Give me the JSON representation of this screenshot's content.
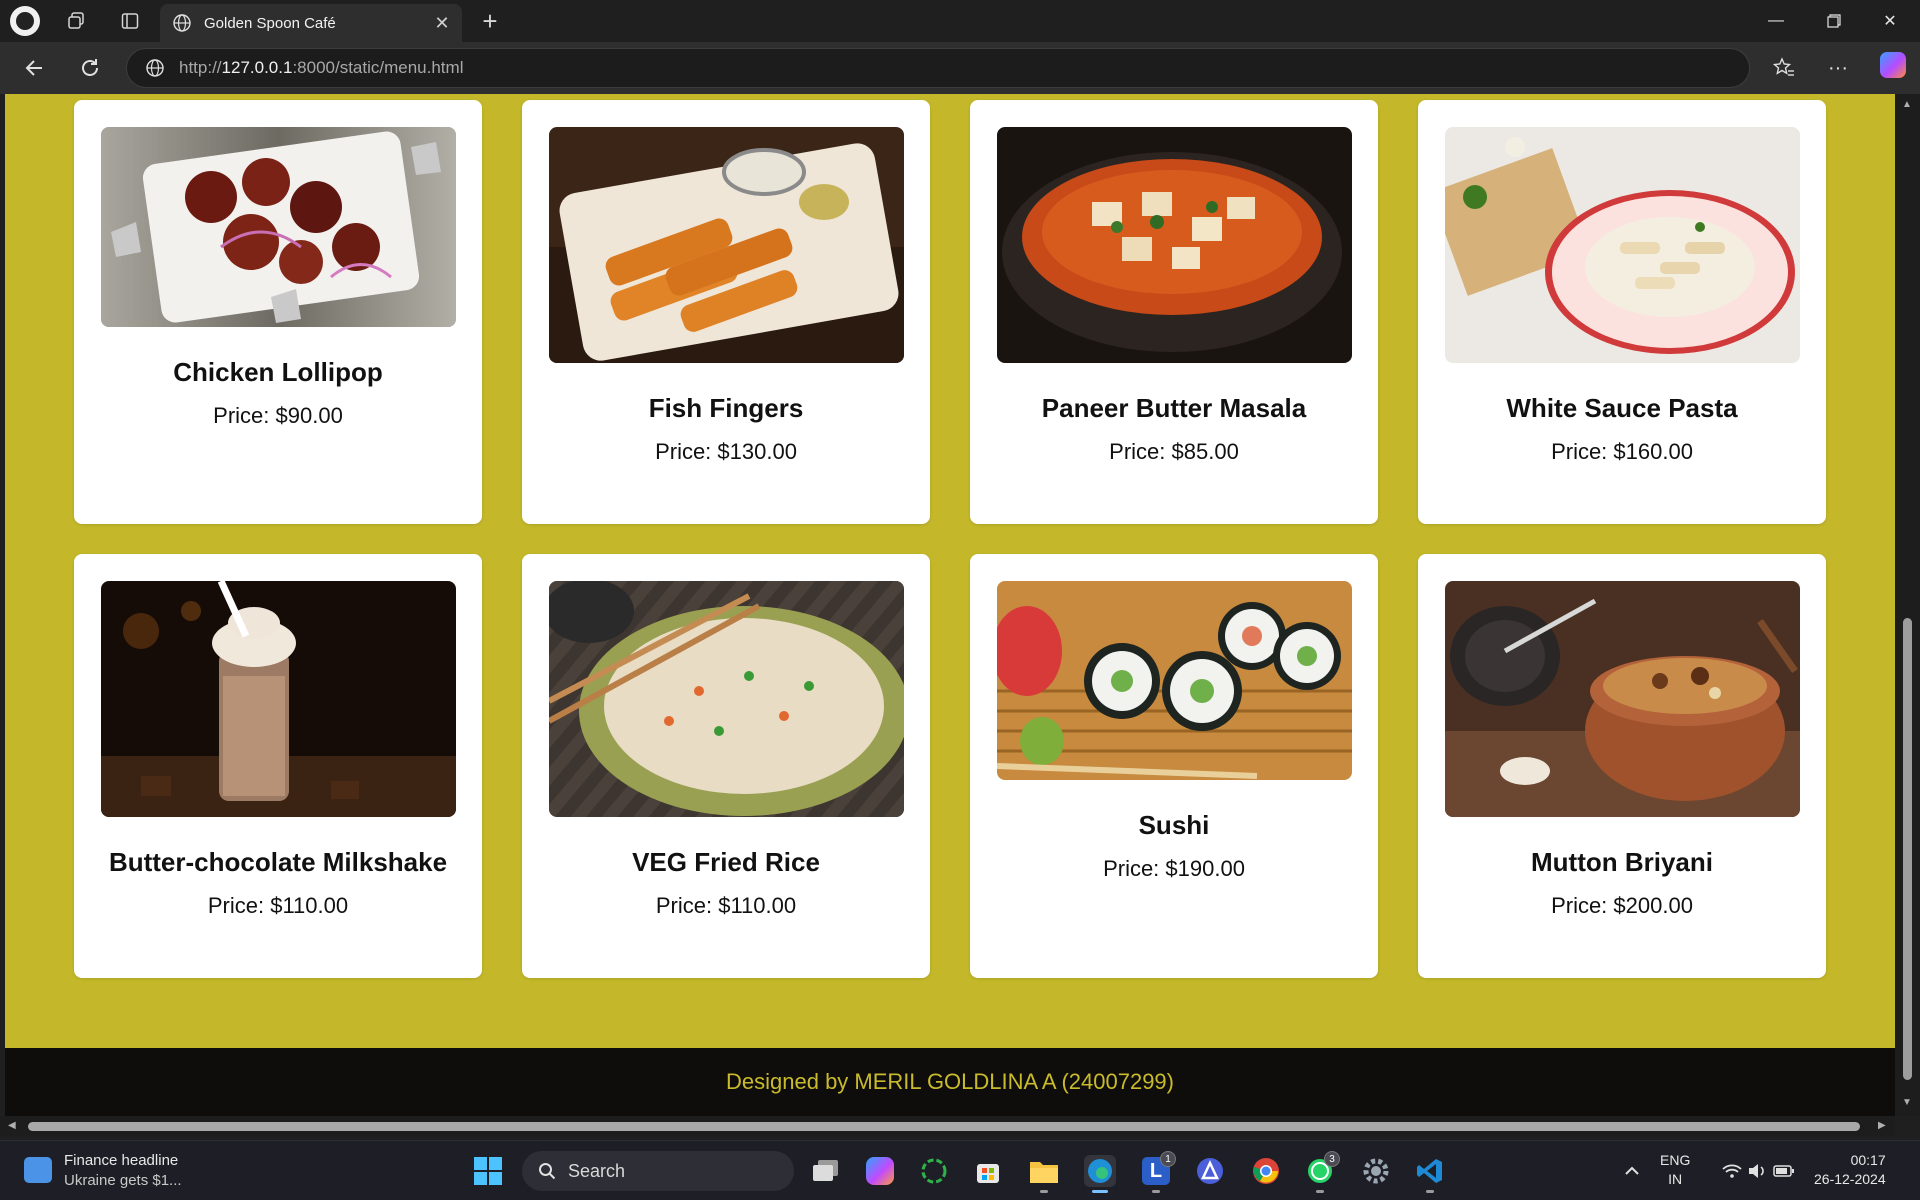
{
  "browser": {
    "tab_title": "Golden Spoon Café",
    "url_prefix": "http://",
    "url_host": "127.0.0.1",
    "url_rest": ":8000/static/menu.html"
  },
  "menu": {
    "items": [
      {
        "name": "Chicken Lollipop",
        "price": "Price: $90.00"
      },
      {
        "name": "Fish Fingers",
        "price": "Price: $130.00"
      },
      {
        "name": "Paneer Butter Masala",
        "price": "Price: $85.00"
      },
      {
        "name": "White Sauce Pasta",
        "price": "Price: $160.00"
      },
      {
        "name": "Butter-chocolate Milkshake",
        "price": "Price: $110.00"
      },
      {
        "name": "VEG Fried Rice",
        "price": "Price: $110.00"
      },
      {
        "name": "Sushi",
        "price": "Price: $190.00"
      },
      {
        "name": "Mutton Briyani",
        "price": "Price: $200.00"
      }
    ]
  },
  "footer": {
    "text": "Designed by MERIL GOLDLINA A (24007299)"
  },
  "taskbar": {
    "news_title": "Finance headline",
    "news_sub": "Ukraine gets $1...",
    "search_label": "Search",
    "badge_l": "1",
    "badge_whatsapp": "3",
    "lang_1": "ENG",
    "lang_2": "IN",
    "time": "00:17",
    "date": "26-12-2024"
  },
  "colors": {
    "page_background": "#c4b82a",
    "footer_background": "#0e0d0b",
    "footer_text": "#c9bb2c",
    "card_background": "#ffffff"
  }
}
